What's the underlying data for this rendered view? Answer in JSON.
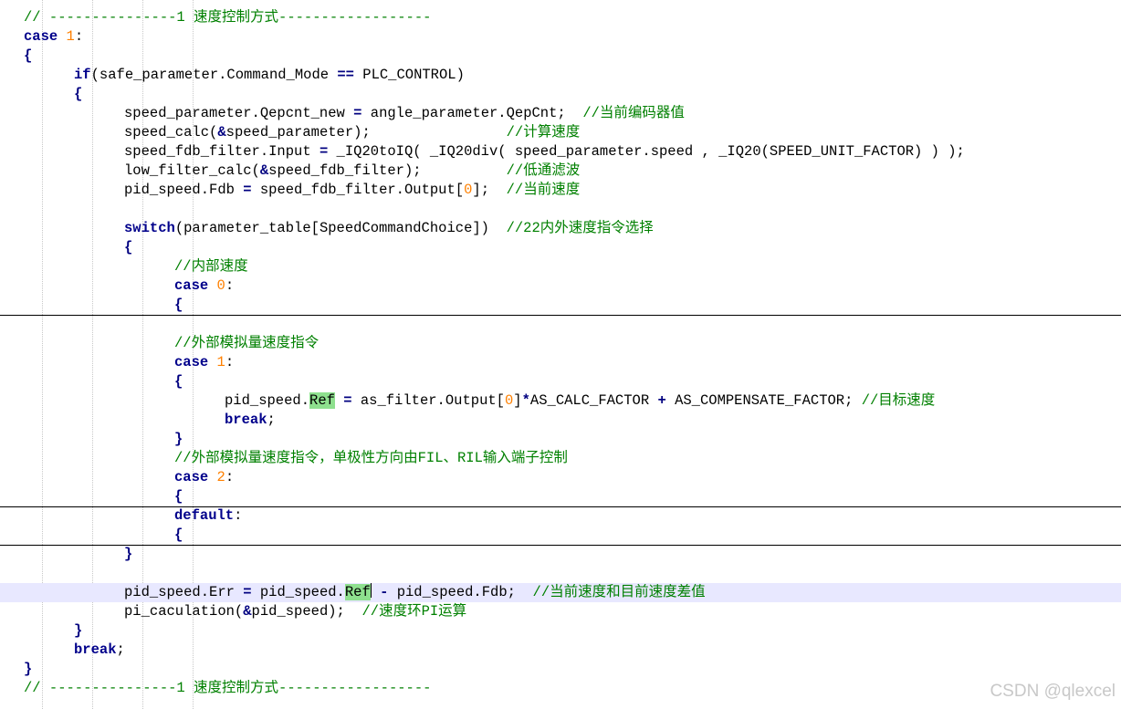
{
  "editor": {
    "language": "C",
    "current_line_index": 30,
    "colors": {
      "keyword": "#00008b",
      "number": "#ff8000",
      "comment": "#008000",
      "highlight": "#8ee08e",
      "current_line": "#e8e8ff",
      "guide": "#c8c8c8"
    },
    "lines": [
      {
        "indent": 0,
        "tokens": [
          {
            "t": "// ---------------1 速度控制方式------------------",
            "c": "cm"
          }
        ]
      },
      {
        "indent": 0,
        "tokens": [
          {
            "t": "case",
            "c": "kw"
          },
          {
            "t": " "
          },
          {
            "t": "1",
            "c": "num"
          },
          {
            "t": ":"
          }
        ]
      },
      {
        "indent": 0,
        "tokens": [
          {
            "t": "{",
            "c": "op"
          }
        ]
      },
      {
        "indent": 1,
        "tokens": [
          {
            "t": "if",
            "c": "kw"
          },
          {
            "t": "(safe_parameter.Command_Mode "
          },
          {
            "t": "==",
            "c": "op"
          },
          {
            "t": " PLC_CONTROL)"
          }
        ]
      },
      {
        "indent": 1,
        "tokens": [
          {
            "t": "{",
            "c": "op"
          }
        ]
      },
      {
        "indent": 2,
        "tokens": [
          {
            "t": "speed_parameter.Qepcnt_new "
          },
          {
            "t": "=",
            "c": "op"
          },
          {
            "t": " angle_parameter.QepCnt;  "
          },
          {
            "t": "//当前编码器值",
            "c": "cm"
          }
        ]
      },
      {
        "indent": 2,
        "tokens": [
          {
            "t": "speed_calc("
          },
          {
            "t": "&",
            "c": "op"
          },
          {
            "t": "speed_parameter);                "
          },
          {
            "t": "//计算速度",
            "c": "cm"
          }
        ]
      },
      {
        "indent": 2,
        "tokens": [
          {
            "t": "speed_fdb_filter.Input "
          },
          {
            "t": "=",
            "c": "op"
          },
          {
            "t": " _IQ20toIQ( _IQ20div( speed_parameter.speed , _IQ20(SPEED_UNIT_FACTOR) ) );"
          }
        ]
      },
      {
        "indent": 2,
        "tokens": [
          {
            "t": "low_filter_calc("
          },
          {
            "t": "&",
            "c": "op"
          },
          {
            "t": "speed_fdb_filter);          "
          },
          {
            "t": "//低通滤波",
            "c": "cm"
          }
        ]
      },
      {
        "indent": 2,
        "tokens": [
          {
            "t": "pid_speed.Fdb "
          },
          {
            "t": "=",
            "c": "op"
          },
          {
            "t": " speed_fdb_filter.Output["
          },
          {
            "t": "0",
            "c": "num"
          },
          {
            "t": "];  "
          },
          {
            "t": "//当前速度",
            "c": "cm"
          }
        ]
      },
      {
        "indent": 2,
        "tokens": []
      },
      {
        "indent": 2,
        "tokens": [
          {
            "t": "switch",
            "c": "kw"
          },
          {
            "t": "(parameter_table[SpeedCommandChoice])  "
          },
          {
            "t": "//22内外速度指令选择",
            "c": "cm"
          }
        ]
      },
      {
        "indent": 2,
        "tokens": [
          {
            "t": "{",
            "c": "op"
          }
        ]
      },
      {
        "indent": 3,
        "tokens": [
          {
            "t": "//内部速度",
            "c": "cm"
          }
        ]
      },
      {
        "indent": 3,
        "tokens": [
          {
            "t": "case",
            "c": "kw"
          },
          {
            "t": " "
          },
          {
            "t": "0",
            "c": "num"
          },
          {
            "t": ":"
          }
        ]
      },
      {
        "indent": 3,
        "tokens": [
          {
            "t": "{",
            "c": "op"
          }
        ]
      },
      {
        "indent": 3,
        "tokens": []
      },
      {
        "indent": 3,
        "tokens": [
          {
            "t": "//外部模拟量速度指令",
            "c": "cm"
          }
        ]
      },
      {
        "indent": 3,
        "tokens": [
          {
            "t": "case",
            "c": "kw"
          },
          {
            "t": " "
          },
          {
            "t": "1",
            "c": "num"
          },
          {
            "t": ":"
          }
        ]
      },
      {
        "indent": 3,
        "tokens": [
          {
            "t": "{",
            "c": "op"
          }
        ]
      },
      {
        "indent": 4,
        "tokens": [
          {
            "t": "pid_speed."
          },
          {
            "t": "Ref",
            "c": "hl"
          },
          {
            "t": " "
          },
          {
            "t": "=",
            "c": "op"
          },
          {
            "t": " as_filter.Output["
          },
          {
            "t": "0",
            "c": "num"
          },
          {
            "t": "]"
          },
          {
            "t": "*",
            "c": "op"
          },
          {
            "t": "AS_CALC_FACTOR "
          },
          {
            "t": "+",
            "c": "op"
          },
          {
            "t": " AS_COMPENSATE_FACTOR; "
          },
          {
            "t": "//目标速度",
            "c": "cm"
          }
        ]
      },
      {
        "indent": 4,
        "tokens": [
          {
            "t": "break",
            "c": "kw"
          },
          {
            "t": ";"
          }
        ]
      },
      {
        "indent": 3,
        "tokens": [
          {
            "t": "}",
            "c": "op"
          }
        ]
      },
      {
        "indent": 3,
        "tokens": [
          {
            "t": "//外部模拟量速度指令，单极性方向由FIL、RIL输入端子控制",
            "c": "cm"
          }
        ]
      },
      {
        "indent": 3,
        "tokens": [
          {
            "t": "case",
            "c": "kw"
          },
          {
            "t": " "
          },
          {
            "t": "2",
            "c": "num"
          },
          {
            "t": ":"
          }
        ]
      },
      {
        "indent": 3,
        "tokens": [
          {
            "t": "{",
            "c": "op"
          }
        ]
      },
      {
        "indent": 3,
        "tokens": [
          {
            "t": "default",
            "c": "kw"
          },
          {
            "t": ":"
          }
        ]
      },
      {
        "indent": 3,
        "tokens": [
          {
            "t": "{",
            "c": "op"
          }
        ]
      },
      {
        "indent": 2,
        "tokens": [
          {
            "t": "}",
            "c": "op"
          }
        ]
      },
      {
        "indent": 2,
        "tokens": []
      },
      {
        "indent": 2,
        "tokens": [
          {
            "t": "pid_speed.Err "
          },
          {
            "t": "=",
            "c": "op"
          },
          {
            "t": " pid_speed."
          },
          {
            "t": "Ref",
            "c": "hl",
            "caret": true
          },
          {
            "t": " "
          },
          {
            "t": "-",
            "c": "op"
          },
          {
            "t": " pid_speed.Fdb;  "
          },
          {
            "t": "//当前速度和目前速度差值",
            "c": "cm"
          }
        ]
      },
      {
        "indent": 2,
        "tokens": [
          {
            "t": "pi_caculation("
          },
          {
            "t": "&",
            "c": "op"
          },
          {
            "t": "pid_speed);  "
          },
          {
            "t": "//速度环PI运算",
            "c": "cm"
          }
        ]
      },
      {
        "indent": 1,
        "tokens": [
          {
            "t": "}",
            "c": "op"
          }
        ]
      },
      {
        "indent": 1,
        "tokens": [
          {
            "t": "break",
            "c": "kw"
          },
          {
            "t": ";"
          }
        ]
      },
      {
        "indent": 0,
        "tokens": [
          {
            "t": "}",
            "c": "op"
          }
        ]
      },
      {
        "indent": 0,
        "tokens": [
          {
            "t": "// ---------------1 速度控制方式------------------",
            "c": "cm"
          }
        ]
      }
    ]
  },
  "watermark": "CSDN @qlexcel"
}
